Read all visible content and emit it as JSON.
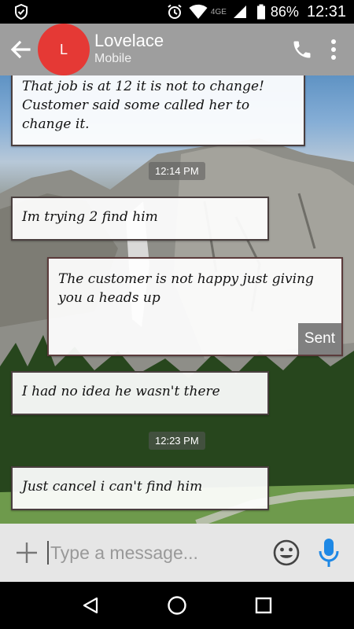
{
  "status_bar": {
    "network": "4GE",
    "battery": "86%",
    "time": "12:31"
  },
  "header": {
    "avatar_letter": "L",
    "avatar_color": "#e53935",
    "contact_name": "Lovelace",
    "contact_subtitle": "Mobile",
    "icons": [
      "back-arrow-icon",
      "phone-icon",
      "more-vert-icon"
    ]
  },
  "conversation": {
    "messages": [
      {
        "direction": "incoming",
        "text_lines": [
          "That job is at 12 it is not to change!",
          "Customer said some called her to",
          "change it."
        ]
      },
      {
        "timestamp": "12:14 PM"
      },
      {
        "direction": "incoming",
        "text_lines": [
          "Im trying 2 find him"
        ]
      },
      {
        "direction": "outgoing",
        "text_lines": [
          "The customer is not happy just giving",
          "you a heads up"
        ],
        "status": "Sent"
      },
      {
        "direction": "incoming",
        "text_lines": [
          "I had no idea he wasn't there"
        ]
      },
      {
        "timestamp": "12:23 PM"
      },
      {
        "direction": "incoming",
        "text_lines": [
          "Just cancel i can't find him"
        ]
      }
    ]
  },
  "compose": {
    "placeholder": "Type a message...",
    "value": "",
    "icons": [
      "plus-icon",
      "emoji-icon",
      "microphone-icon"
    ],
    "mic_color": "#1e88e5"
  },
  "nav_bar": {
    "icons": [
      "back-icon",
      "home-icon",
      "recents-icon"
    ]
  }
}
